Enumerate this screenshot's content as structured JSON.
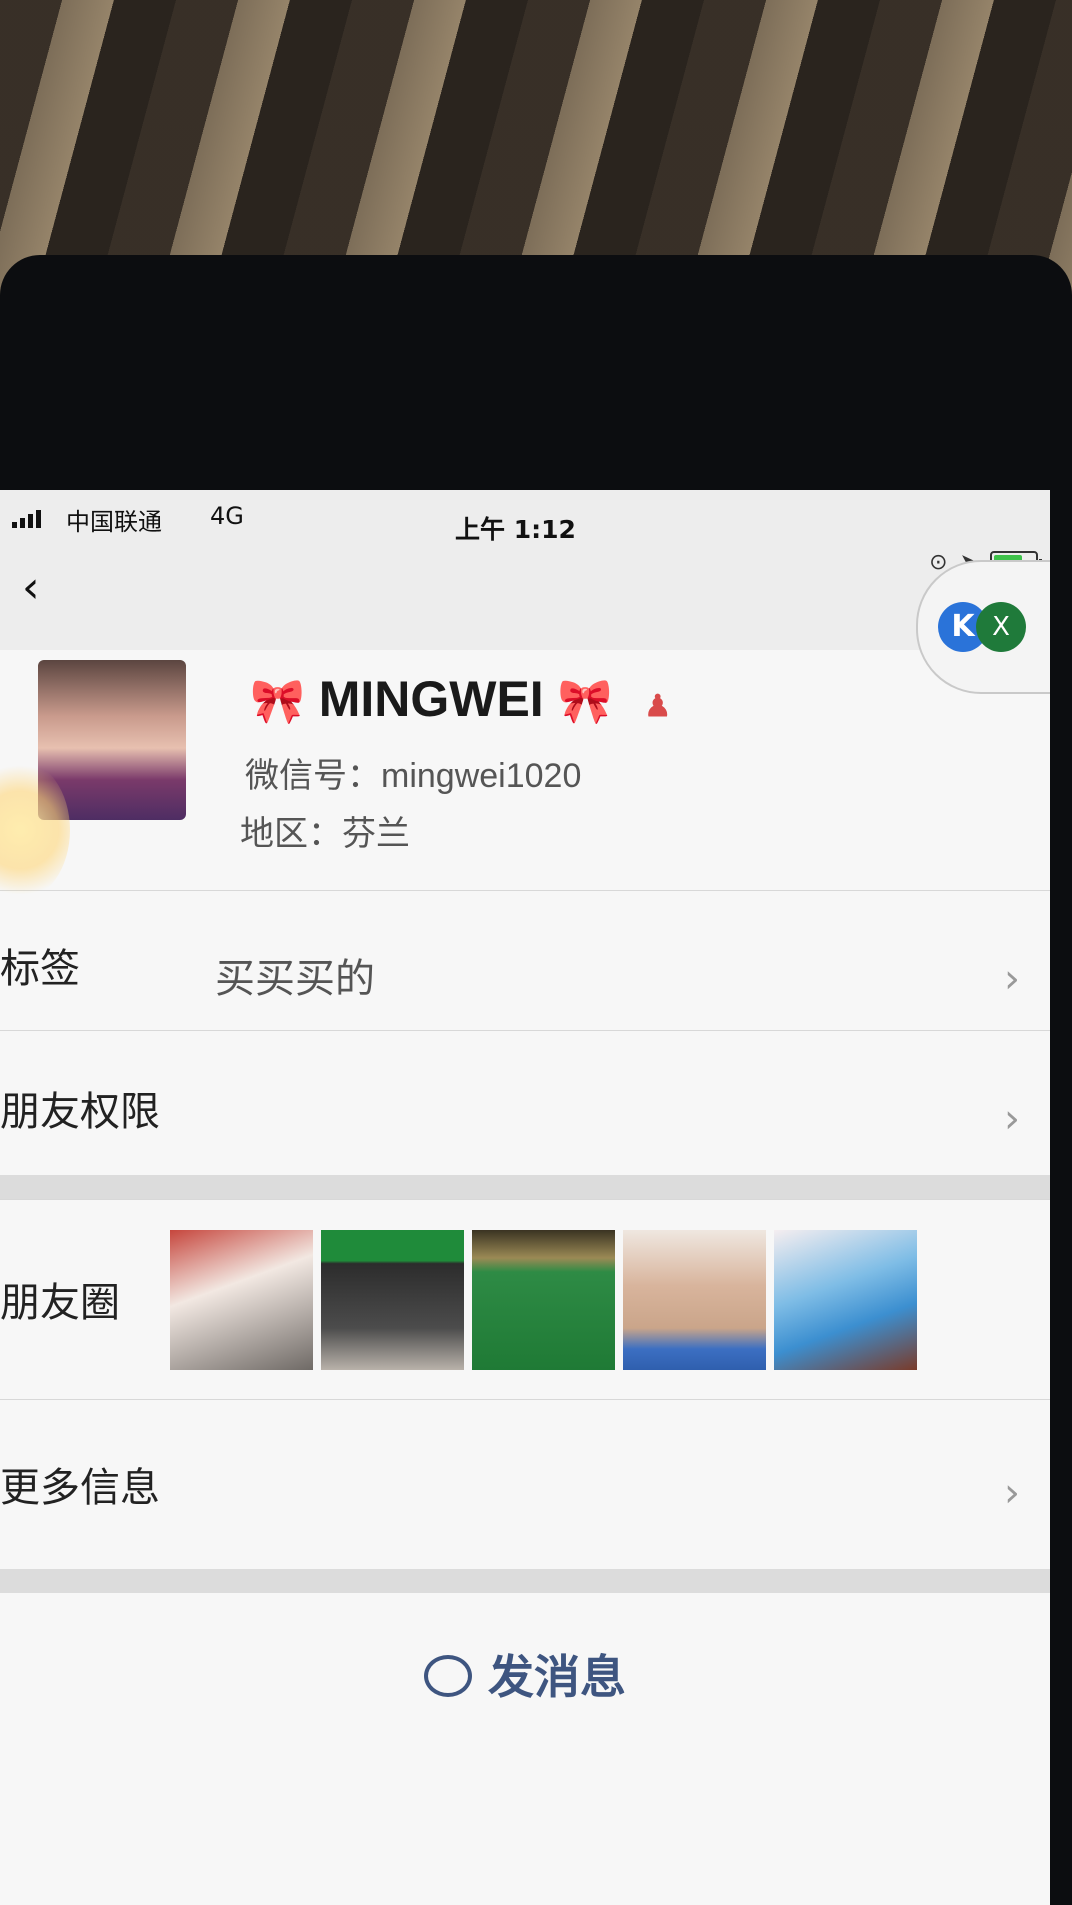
{
  "status_bar": {
    "carrier": "中国联通",
    "network": "4G",
    "time": "上午 1:12",
    "battery_level": 0.7
  },
  "header": {
    "back_icon": "‹",
    "more_icon": "•••"
  },
  "profile": {
    "bow_icon": "🎀",
    "name": "MINGWEI",
    "person_icon": "♟",
    "wechat_id": "微信号：mingwei1020",
    "region": "地区：芬兰"
  },
  "rows": {
    "tags_label": "标签",
    "tags_value": "买买买的",
    "permissions_label": "朋友权限",
    "moments_label": "朋友圈",
    "more_info_label": "更多信息"
  },
  "chevron_icon": "›",
  "floater": {
    "left_badge": "K",
    "right_badge": "X"
  },
  "actions": {
    "send_message": "发消息"
  }
}
